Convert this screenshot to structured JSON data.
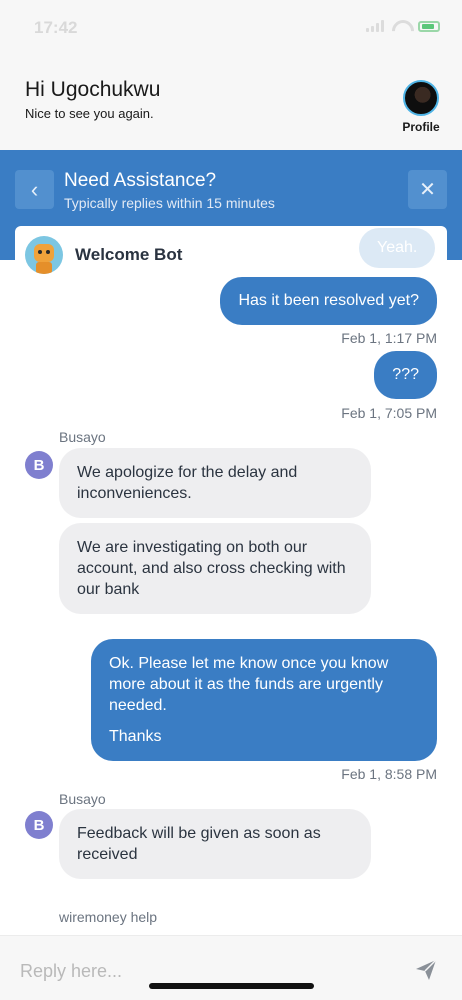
{
  "status_bar": {
    "time": "17:42"
  },
  "header": {
    "greeting": "Hi Ugochukwu",
    "subtitle": "Nice to see you again.",
    "profile_label": "Profile"
  },
  "assistance": {
    "title": "Need Assistance?",
    "subtitle": "Typically replies within 15 minutes",
    "back_glyph": "‹",
    "close_glyph": "✕"
  },
  "chat": {
    "bot_name": "Welcome Bot",
    "faded_message": "Yeah.",
    "msg1": "Has it been resolved yet?",
    "time1": "Feb 1, 1:17 PM",
    "msg2": "???",
    "time2": "Feb 1, 7:05 PM",
    "sender1": "Busayo",
    "badge1": "B",
    "in1": "We apologize for the delay and inconveniences.",
    "in2": "We are investigating on both our account, and also cross checking with our bank",
    "out3_line1": "Ok. Please let me know once you know more about it as the funds are urgently needed.",
    "out3_line2": "Thanks",
    "time3": "Feb 1, 8:58 PM",
    "sender2": "Busayo",
    "badge2": "B",
    "in3": "Feedback will be given as soon as received",
    "footer_label": "wiremoney help"
  },
  "compose": {
    "placeholder": "Reply here..."
  },
  "colors": {
    "brand_blue": "#3a7dc4",
    "incoming_bubble": "#eeeef0",
    "badge_purple": "#7f7fcf"
  },
  "icons": [
    "back-chevron-icon",
    "close-icon",
    "send-icon",
    "signal-icon",
    "wifi-icon",
    "battery-icon"
  ]
}
